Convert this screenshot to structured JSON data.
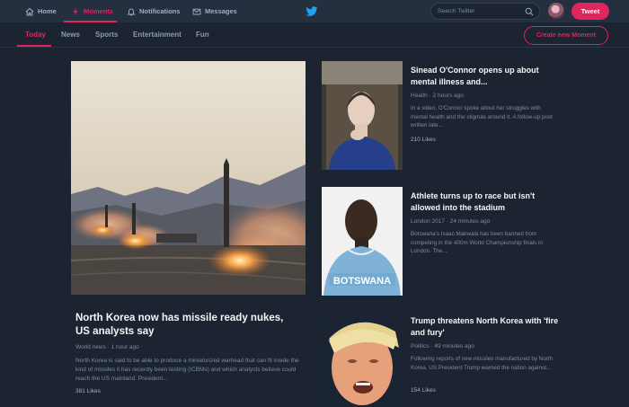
{
  "topnav": {
    "home": "Home",
    "moments": "Moments",
    "notifications": "Notifications",
    "messages": "Messages"
  },
  "search": {
    "placeholder": "Search Twitter"
  },
  "tweet_button": "Tweet",
  "subnav": {
    "tabs": [
      "Today",
      "News",
      "Sports",
      "Entertainment",
      "Fun"
    ],
    "active": "Today",
    "create_moment": "Create new Moment"
  },
  "main_story": {
    "title": "North Korea now has missile ready nukes, US analysts say",
    "meta": "World news · 1 hour ago",
    "description": "North Korea is said to be able to produce a miniaturized warhead that can fit inside the kind of missiles it has recently been testing (ICBMs) and which analysts believe could reach the US mainland. President...",
    "likes": "381 Likes"
  },
  "stories": [
    {
      "title": "Sinead O'Connor opens up about mental illness and...",
      "meta": "Health · 2 hours ago",
      "description": "In a video, O'Connor spoke about her struggles with mental health and the stigmas around it. A follow-up post written late...",
      "likes": "210 Likes"
    },
    {
      "title": "Athlete turns up to race but isn't allowed into the stadium",
      "meta": "London 2017 · 24 minutes ago",
      "description": "Botswana's Isaac Makwala has been banned from competing in the 400m World Championship finals in London. The...",
      "likes": "",
      "jersey_text": "BOTSWANA"
    },
    {
      "title": "Trump threatens North Korea with 'fire and fury'",
      "meta": "Politics · 49 minutes ago",
      "description": "Following reports of new missiles manufactured by North Korea, US President Trump warned the nation against...",
      "likes": "154 Likes"
    }
  ],
  "colors": {
    "background": "#1c2331",
    "topbar": "#243040",
    "accent": "#e0245e",
    "twitter_blue": "#1da1f2"
  }
}
